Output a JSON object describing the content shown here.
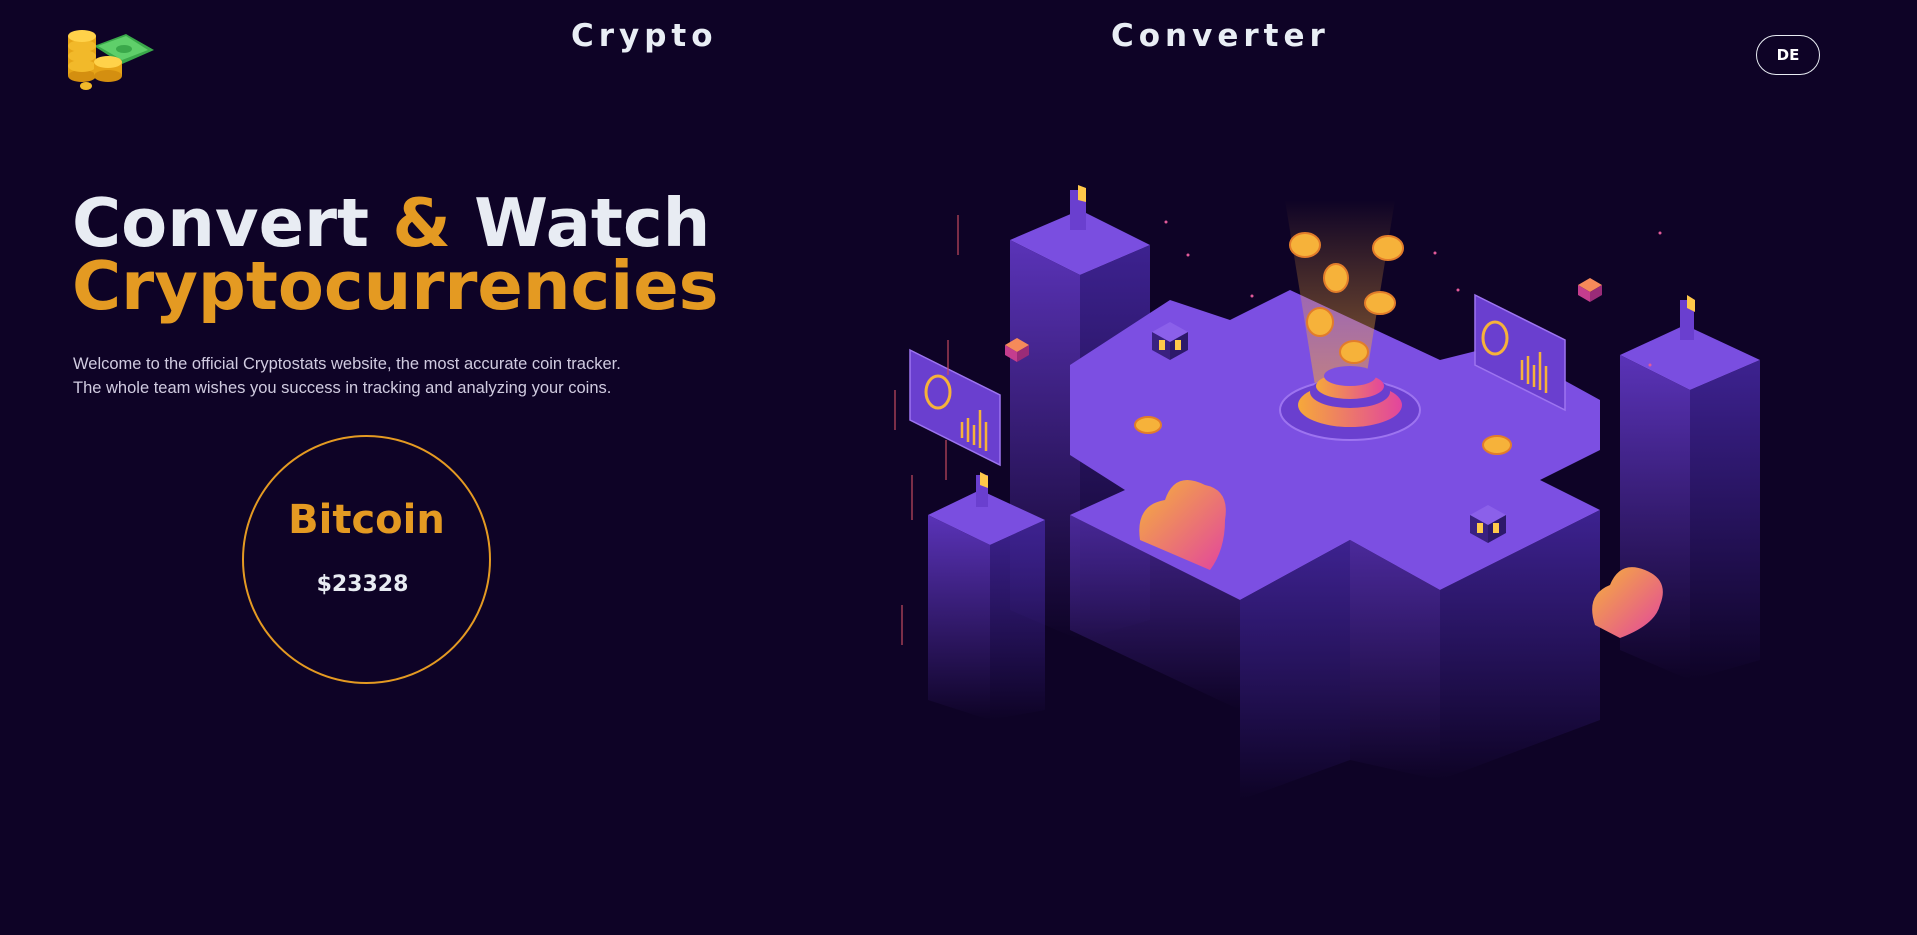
{
  "header": {
    "logo_icon": "coins-and-banknote-icon",
    "nav": [
      {
        "label": "Crypto"
      },
      {
        "label": "Converter"
      }
    ],
    "language_button": "DE"
  },
  "hero": {
    "title_part1": "Convert ",
    "title_amp": "&",
    "title_part2": " Watch",
    "title_line2": "Cryptocurrencies",
    "description_line1": "Welcome to the official Cryptostats website, the most accurate coin tracker.",
    "description_line2": "The whole team wishes you success in tracking and analyzing your coins."
  },
  "coin_card": {
    "name": "Bitcoin",
    "price": "$23328"
  },
  "colors": {
    "background": "#0e0326",
    "accent": "#e49a22",
    "text": "#e8ecf3",
    "purple": "#6a3fcf"
  },
  "illustration": {
    "icon": "isometric-crypto-city-illustration"
  }
}
